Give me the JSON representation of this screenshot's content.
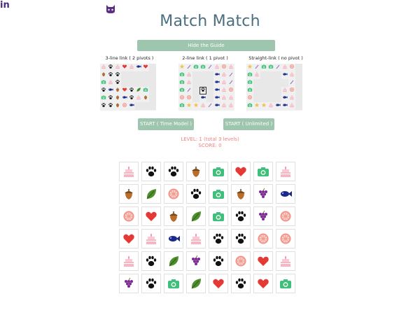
{
  "header": {
    "title": "Match Match",
    "github_icon": "github-cat-icon",
    "linkedin_label": "in"
  },
  "guide": {
    "hide_button": "Hide the Guide",
    "examples": [
      {
        "label": "3-line link ( 2 pivots )"
      },
      {
        "label": "2-line link ( 1 pivot )"
      },
      {
        "label": "Straight-link ( no pivot )"
      }
    ]
  },
  "controls": {
    "start_time": "START ( Time Model )",
    "start_unlimited": "START ( Unlimited )"
  },
  "status": {
    "level": "LEVEL: 1 (total 3 levels)",
    "score": "SCORE: 0"
  },
  "colors": {
    "accent": "#9ec5ae",
    "title": "#4a6f7e",
    "status": "#f08080"
  },
  "board": {
    "rows": [
      [
        "cake",
        "paw",
        "paw",
        "acorn",
        "camera",
        "heart",
        "camera",
        "cake"
      ],
      [
        "acorn",
        "leaf",
        "orange",
        "paw",
        "camera",
        "acorn",
        "grapes",
        "fish"
      ],
      [
        "orange",
        "heart",
        "acorn",
        "leaf",
        "camera",
        "paw",
        "grapes",
        "orange"
      ],
      [
        "heart",
        "cake",
        "fish",
        "cake",
        "paw",
        "paw",
        "orange",
        "orange"
      ],
      [
        "cake",
        "paw",
        "leaf",
        "grapes",
        "paw",
        "orange",
        "heart",
        "cake"
      ],
      [
        "grapes",
        "paw",
        "camera",
        "leaf",
        "heart",
        "paw",
        "heart",
        "camera"
      ]
    ]
  },
  "mini_boards": [
    {
      "rows": [
        [
          "cake",
          "paw",
          "cake",
          "heart",
          "cake",
          "fish",
          "heart",
          "e"
        ],
        [
          "acorn",
          "paw",
          "paw",
          "e",
          "e",
          "e",
          "e",
          "e"
        ],
        [
          "camera",
          "cake",
          "paw",
          "e",
          "e",
          "e",
          "e",
          "e"
        ],
        [
          "paw",
          "fish",
          "acorn",
          "heart",
          "paw",
          "leaf",
          "camera",
          "e"
        ],
        [
          "camera",
          "paw",
          "acorn",
          "fish",
          "paw",
          "cake",
          "acorn",
          "e"
        ],
        [
          "paw",
          "paw",
          "acorn",
          "orange",
          "fish",
          "e",
          "e",
          "e"
        ]
      ]
    },
    {
      "rows": [
        [
          "star",
          "pen",
          "camera",
          "camera",
          "pen",
          "cake",
          "orange",
          "cake"
        ],
        [
          "camera",
          "cake",
          "e",
          "e",
          "e",
          "fish",
          "cake",
          "pen"
        ],
        [
          "camera",
          "cake",
          "e",
          "e",
          "e",
          "fish",
          "cake",
          "pen"
        ],
        [
          "camera",
          "pen",
          "e",
          "paw",
          "e",
          "fish",
          "cake",
          "orange"
        ],
        [
          "orange",
          "orange",
          "e",
          "fish",
          "e",
          "fish",
          "cake",
          "cake"
        ],
        [
          "camera",
          "star",
          "star",
          "cake",
          "pen",
          "fish",
          "cake",
          "cake"
        ]
      ]
    },
    {
      "rows": [
        [
          "star",
          "pen",
          "camera",
          "camera",
          "pen",
          "cake",
          "orange",
          "e"
        ],
        [
          "camera",
          "cake",
          "e",
          "e",
          "e",
          "fish",
          "cake",
          "e"
        ],
        [
          "camera",
          "e",
          "e",
          "e",
          "e",
          "e",
          "pen",
          "e"
        ],
        [
          "camera",
          "e",
          "e",
          "e",
          "e",
          "cake",
          "orange",
          "e"
        ],
        [
          "orange",
          "e",
          "e",
          "e",
          "e",
          "fish",
          "cake",
          "e"
        ],
        [
          "camera",
          "star",
          "star",
          "cake",
          "fish",
          "fish",
          "cake",
          "e"
        ]
      ]
    }
  ]
}
